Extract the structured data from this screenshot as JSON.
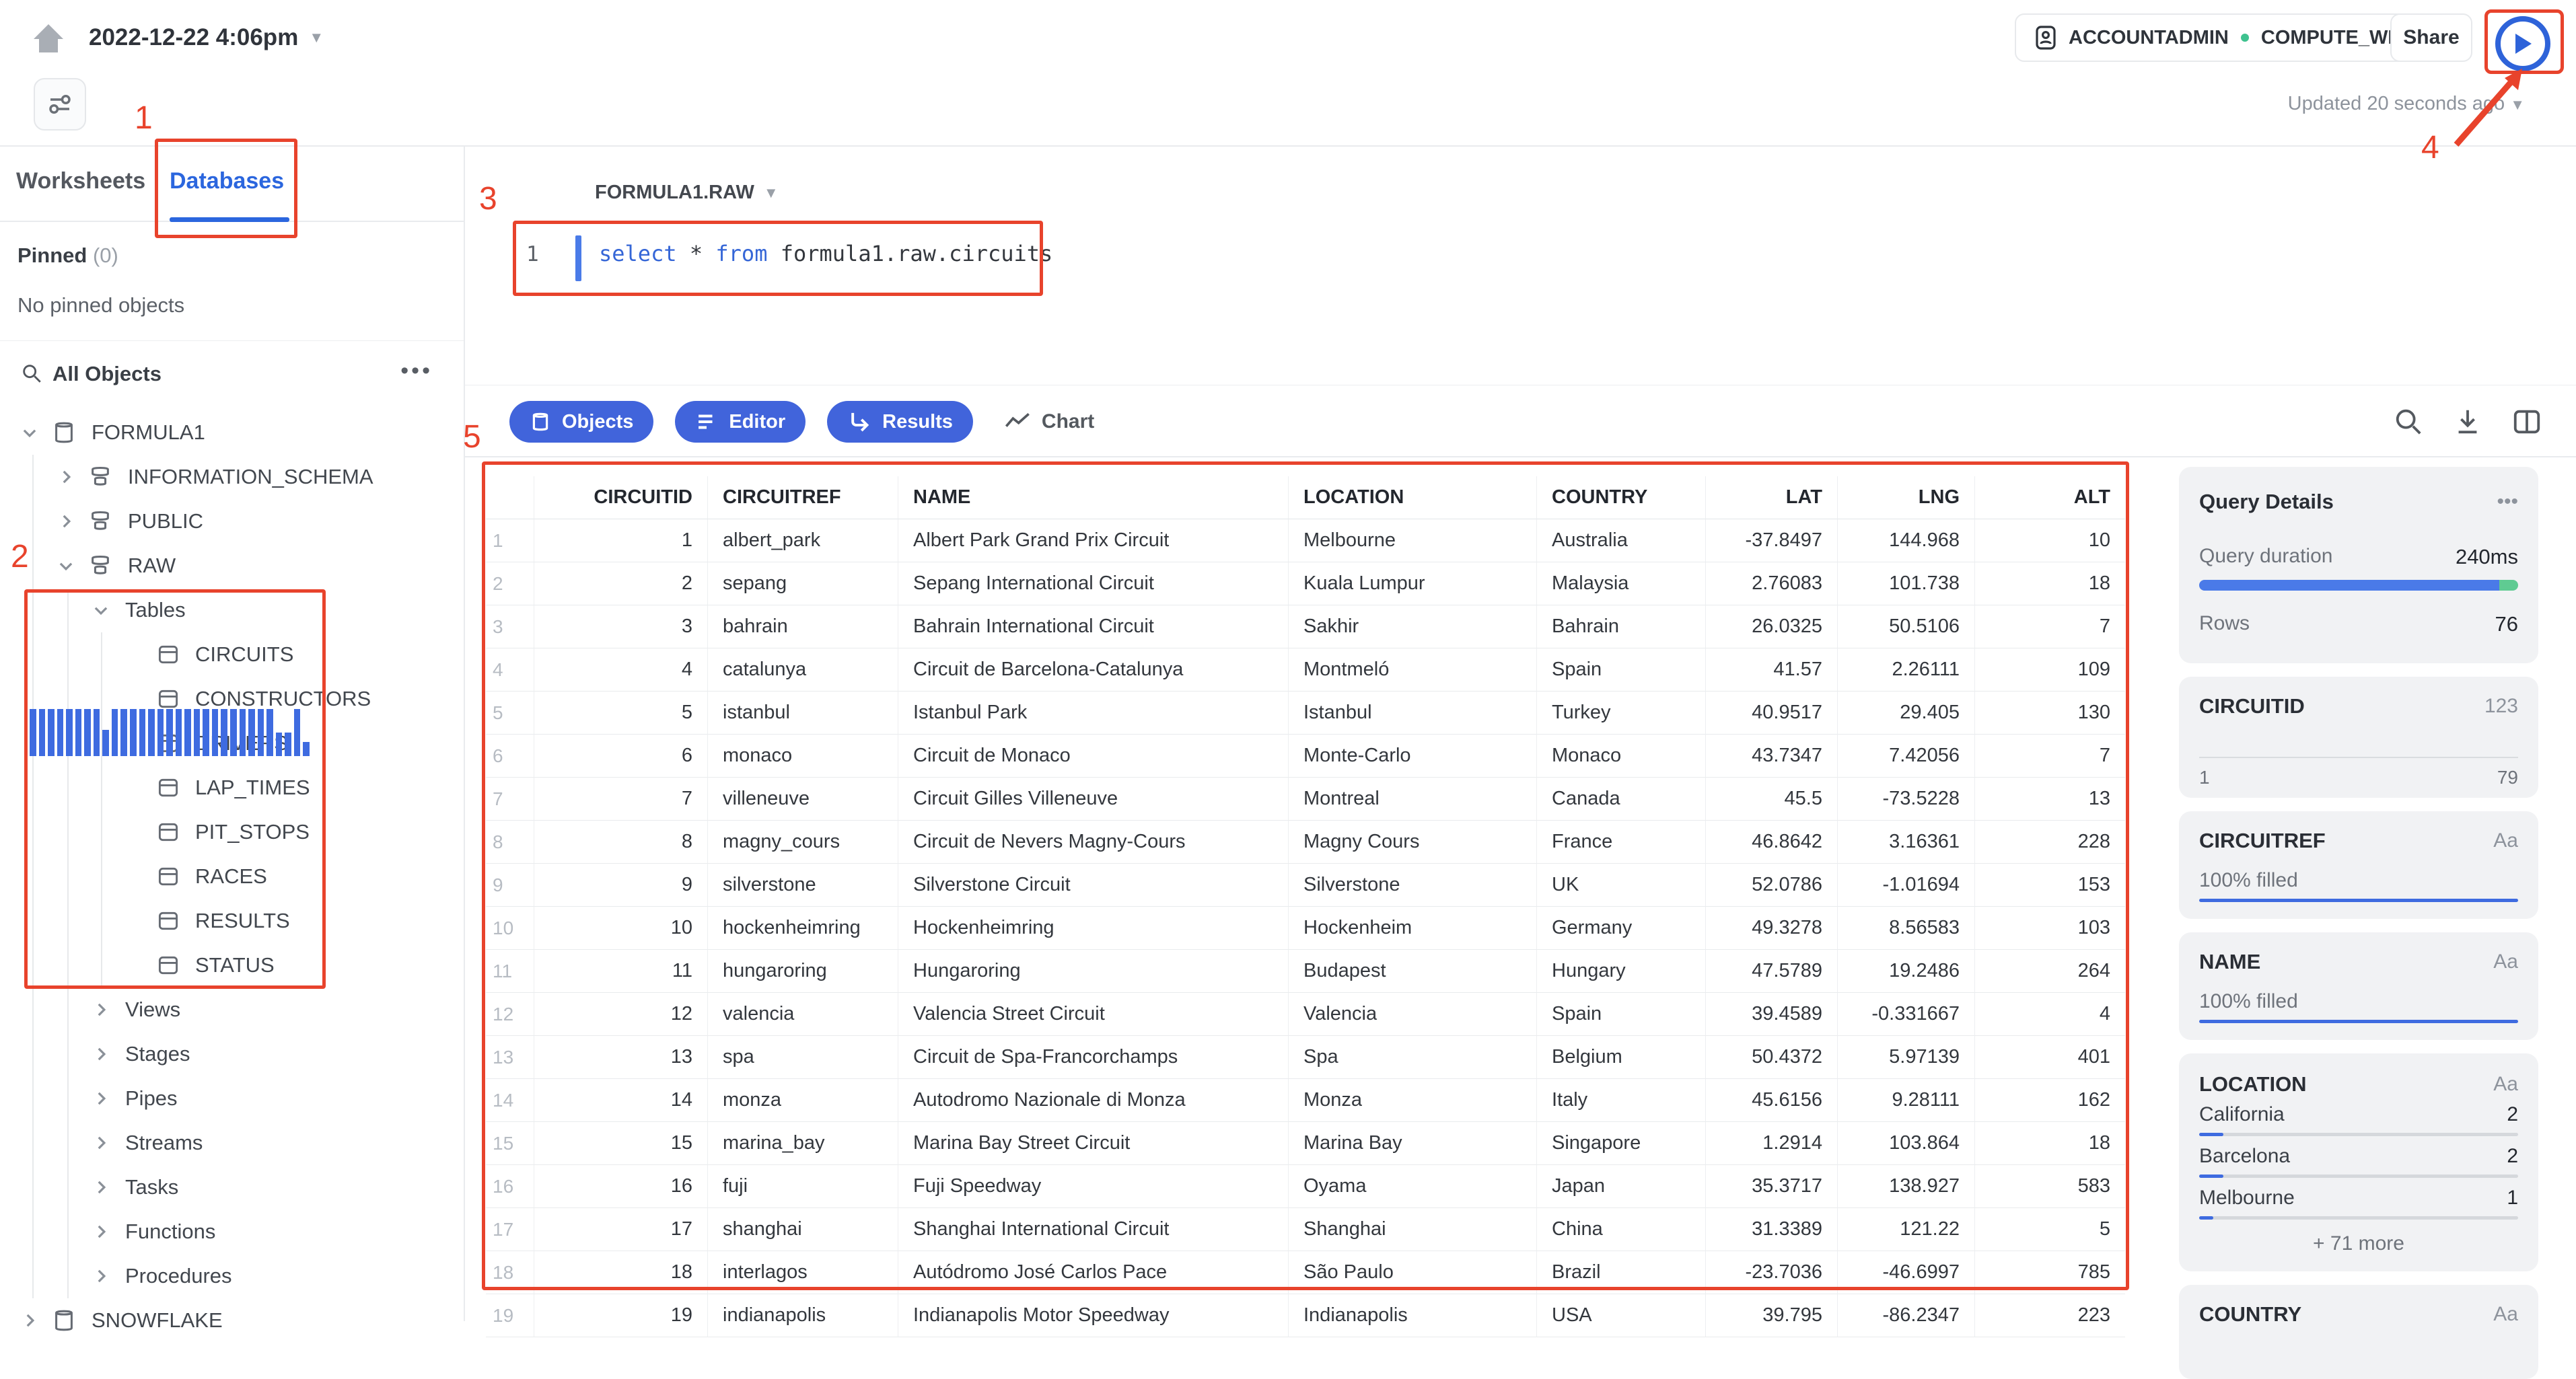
{
  "colors": {
    "accent_blue": "#2B66DE",
    "pill_blue": "#4164DB",
    "sql_keyword": "#3566D7",
    "progress_blue": "#4A7AE8",
    "progress_green": "#5FCB92",
    "bar_blue": "#3E6BE0",
    "annotation_red": "#E8432C",
    "card_bg": "#F1F2F4",
    "green_dot": "#3EC28F"
  },
  "header": {
    "timestamp": "2022-12-22 4:06pm",
    "role": "ACCOUNTADMIN",
    "warehouse": "COMPUTE_WH",
    "share_label": "Share",
    "updated": "Updated 20 seconds ago"
  },
  "sidebar": {
    "tabs": {
      "worksheets": "Worksheets",
      "databases": "Databases"
    },
    "pinned_label": "Pinned",
    "pinned_count": "(0)",
    "empty_text": "No pinned objects",
    "search_label": "All Objects",
    "tree": [
      {
        "label": "FORMULA1",
        "level": 0,
        "chevron": "down",
        "icon": "db"
      },
      {
        "label": "INFORMATION_SCHEMA",
        "level": 1,
        "chevron": "right",
        "icon": "schema"
      },
      {
        "label": "PUBLIC",
        "level": 1,
        "chevron": "right",
        "icon": "schema"
      },
      {
        "label": "RAW",
        "level": 1,
        "chevron": "down",
        "icon": "schema"
      },
      {
        "label": "Tables",
        "level": 2,
        "chevron": "down",
        "icon": null
      },
      {
        "label": "CIRCUITS",
        "level": 3,
        "chevron": null,
        "icon": "table"
      },
      {
        "label": "CONSTRUCTORS",
        "level": 3,
        "chevron": null,
        "icon": "table"
      },
      {
        "label": "DRIVERS",
        "level": 3,
        "chevron": null,
        "icon": "table"
      },
      {
        "label": "LAP_TIMES",
        "level": 3,
        "chevron": null,
        "icon": "table"
      },
      {
        "label": "PIT_STOPS",
        "level": 3,
        "chevron": null,
        "icon": "table"
      },
      {
        "label": "RACES",
        "level": 3,
        "chevron": null,
        "icon": "table"
      },
      {
        "label": "RESULTS",
        "level": 3,
        "chevron": null,
        "icon": "table"
      },
      {
        "label": "STATUS",
        "level": 3,
        "chevron": null,
        "icon": "table"
      },
      {
        "label": "Views",
        "level": 2,
        "chevron": "right",
        "icon": null
      },
      {
        "label": "Stages",
        "level": 2,
        "chevron": "right",
        "icon": null
      },
      {
        "label": "Pipes",
        "level": 2,
        "chevron": "right",
        "icon": null
      },
      {
        "label": "Streams",
        "level": 2,
        "chevron": "right",
        "icon": null
      },
      {
        "label": "Tasks",
        "level": 2,
        "chevron": "right",
        "icon": null
      },
      {
        "label": "Functions",
        "level": 2,
        "chevron": "right",
        "icon": null
      },
      {
        "label": "Procedures",
        "level": 2,
        "chevron": "right",
        "icon": null
      },
      {
        "label": "SNOWFLAKE",
        "level": 0,
        "chevron": "right",
        "icon": "db"
      }
    ]
  },
  "editor": {
    "context": "FORMULA1.RAW",
    "line_number": "1",
    "sql_tokens": [
      {
        "t": "select",
        "c": "kw"
      },
      {
        "t": " * ",
        "c": "tx"
      },
      {
        "t": "from",
        "c": "kw"
      },
      {
        "t": " formula1.raw.circuits",
        "c": "tx"
      }
    ]
  },
  "tabs": [
    {
      "label": "Objects",
      "icon": "database-icon",
      "pill": true
    },
    {
      "label": "Editor",
      "icon": "editor-icon",
      "pill": true
    },
    {
      "label": "Results",
      "icon": "results-icon",
      "pill": true
    },
    {
      "label": "Chart",
      "icon": "chart-icon",
      "pill": false
    }
  ],
  "table": {
    "columns": [
      {
        "label": "",
        "align": "left"
      },
      {
        "label": "CIRCUITID",
        "align": "right"
      },
      {
        "label": "CIRCUITREF",
        "align": "left"
      },
      {
        "label": "NAME",
        "align": "left"
      },
      {
        "label": "LOCATION",
        "align": "left"
      },
      {
        "label": "COUNTRY",
        "align": "left"
      },
      {
        "label": "LAT",
        "align": "right"
      },
      {
        "label": "LNG",
        "align": "right"
      },
      {
        "label": "ALT",
        "align": "right"
      }
    ],
    "rows": [
      [
        "1",
        "1",
        "albert_park",
        "Albert Park Grand Prix Circuit",
        "Melbourne",
        "Australia",
        "-37.8497",
        "144.968",
        "10"
      ],
      [
        "2",
        "2",
        "sepang",
        "Sepang International Circuit",
        "Kuala Lumpur",
        "Malaysia",
        "2.76083",
        "101.738",
        "18"
      ],
      [
        "3",
        "3",
        "bahrain",
        "Bahrain International Circuit",
        "Sakhir",
        "Bahrain",
        "26.0325",
        "50.5106",
        "7"
      ],
      [
        "4",
        "4",
        "catalunya",
        "Circuit de Barcelona-Catalunya",
        "Montmeló",
        "Spain",
        "41.57",
        "2.26111",
        "109"
      ],
      [
        "5",
        "5",
        "istanbul",
        "Istanbul Park",
        "Istanbul",
        "Turkey",
        "40.9517",
        "29.405",
        "130"
      ],
      [
        "6",
        "6",
        "monaco",
        "Circuit de Monaco",
        "Monte-Carlo",
        "Monaco",
        "43.7347",
        "7.42056",
        "7"
      ],
      [
        "7",
        "7",
        "villeneuve",
        "Circuit Gilles Villeneuve",
        "Montreal",
        "Canada",
        "45.5",
        "-73.5228",
        "13"
      ],
      [
        "8",
        "8",
        "magny_cours",
        "Circuit de Nevers Magny-Cours",
        "Magny Cours",
        "France",
        "46.8642",
        "3.16361",
        "228"
      ],
      [
        "9",
        "9",
        "silverstone",
        "Silverstone Circuit",
        "Silverstone",
        "UK",
        "52.0786",
        "-1.01694",
        "153"
      ],
      [
        "10",
        "10",
        "hockenheimring",
        "Hockenheimring",
        "Hockenheim",
        "Germany",
        "49.3278",
        "8.56583",
        "103"
      ],
      [
        "11",
        "11",
        "hungaroring",
        "Hungaroring",
        "Budapest",
        "Hungary",
        "47.5789",
        "19.2486",
        "264"
      ],
      [
        "12",
        "12",
        "valencia",
        "Valencia Street Circuit",
        "Valencia",
        "Spain",
        "39.4589",
        "-0.331667",
        "4"
      ],
      [
        "13",
        "13",
        "spa",
        "Circuit de Spa-Francorchamps",
        "Spa",
        "Belgium",
        "50.4372",
        "5.97139",
        "401"
      ],
      [
        "14",
        "14",
        "monza",
        "Autodromo Nazionale di Monza",
        "Monza",
        "Italy",
        "45.6156",
        "9.28111",
        "162"
      ],
      [
        "15",
        "15",
        "marina_bay",
        "Marina Bay Street Circuit",
        "Marina Bay",
        "Singapore",
        "1.2914",
        "103.864",
        "18"
      ],
      [
        "16",
        "16",
        "fuji",
        "Fuji Speedway",
        "Oyama",
        "Japan",
        "35.3717",
        "138.927",
        "583"
      ],
      [
        "17",
        "17",
        "shanghai",
        "Shanghai International Circuit",
        "Shanghai",
        "China",
        "31.3389",
        "121.22",
        "5"
      ],
      [
        "18",
        "18",
        "interlagos",
        "Autódromo José Carlos Pace",
        "São Paulo",
        "Brazil",
        "-23.7036",
        "-46.6997",
        "785"
      ],
      [
        "19",
        "19",
        "indianapolis",
        "Indianapolis Motor Speedway",
        "Indianapolis",
        "USA",
        "39.795",
        "-86.2347",
        "223"
      ]
    ]
  },
  "query_details": {
    "title": "Query Details",
    "duration_label": "Query duration",
    "duration_value": "240ms",
    "rows_label": "Rows",
    "rows_value": "76",
    "blue_fraction": 0.94
  },
  "profile": {
    "circuitid": {
      "title": "CIRCUITID",
      "type": "123",
      "min": "1",
      "max": "79",
      "bars": [
        1,
        1,
        1,
        1,
        1,
        1,
        1,
        1,
        0.55,
        1,
        1,
        1,
        1,
        1,
        1,
        1,
        1,
        1,
        1,
        1,
        1,
        1,
        1,
        1,
        1,
        1,
        1,
        0.5,
        0.5,
        1,
        0.3
      ]
    },
    "circuitref": {
      "title": "CIRCUITREF",
      "type": "Aa",
      "fill": "100% filled"
    },
    "name": {
      "title": "NAME",
      "type": "Aa",
      "fill": "100% filled"
    },
    "location": {
      "title": "LOCATION",
      "type": "Aa",
      "more": "+ 71 more",
      "values": [
        {
          "label": "California",
          "count": "2",
          "frac": 0.075
        },
        {
          "label": "Barcelona",
          "count": "2",
          "frac": 0.075
        },
        {
          "label": "Melbourne",
          "count": "1",
          "frac": 0.045
        }
      ]
    },
    "country": {
      "title": "COUNTRY",
      "type": "Aa"
    }
  },
  "annotations": {
    "n1": "1",
    "n2": "2",
    "n3": "3",
    "n4": "4",
    "n5": "5"
  }
}
